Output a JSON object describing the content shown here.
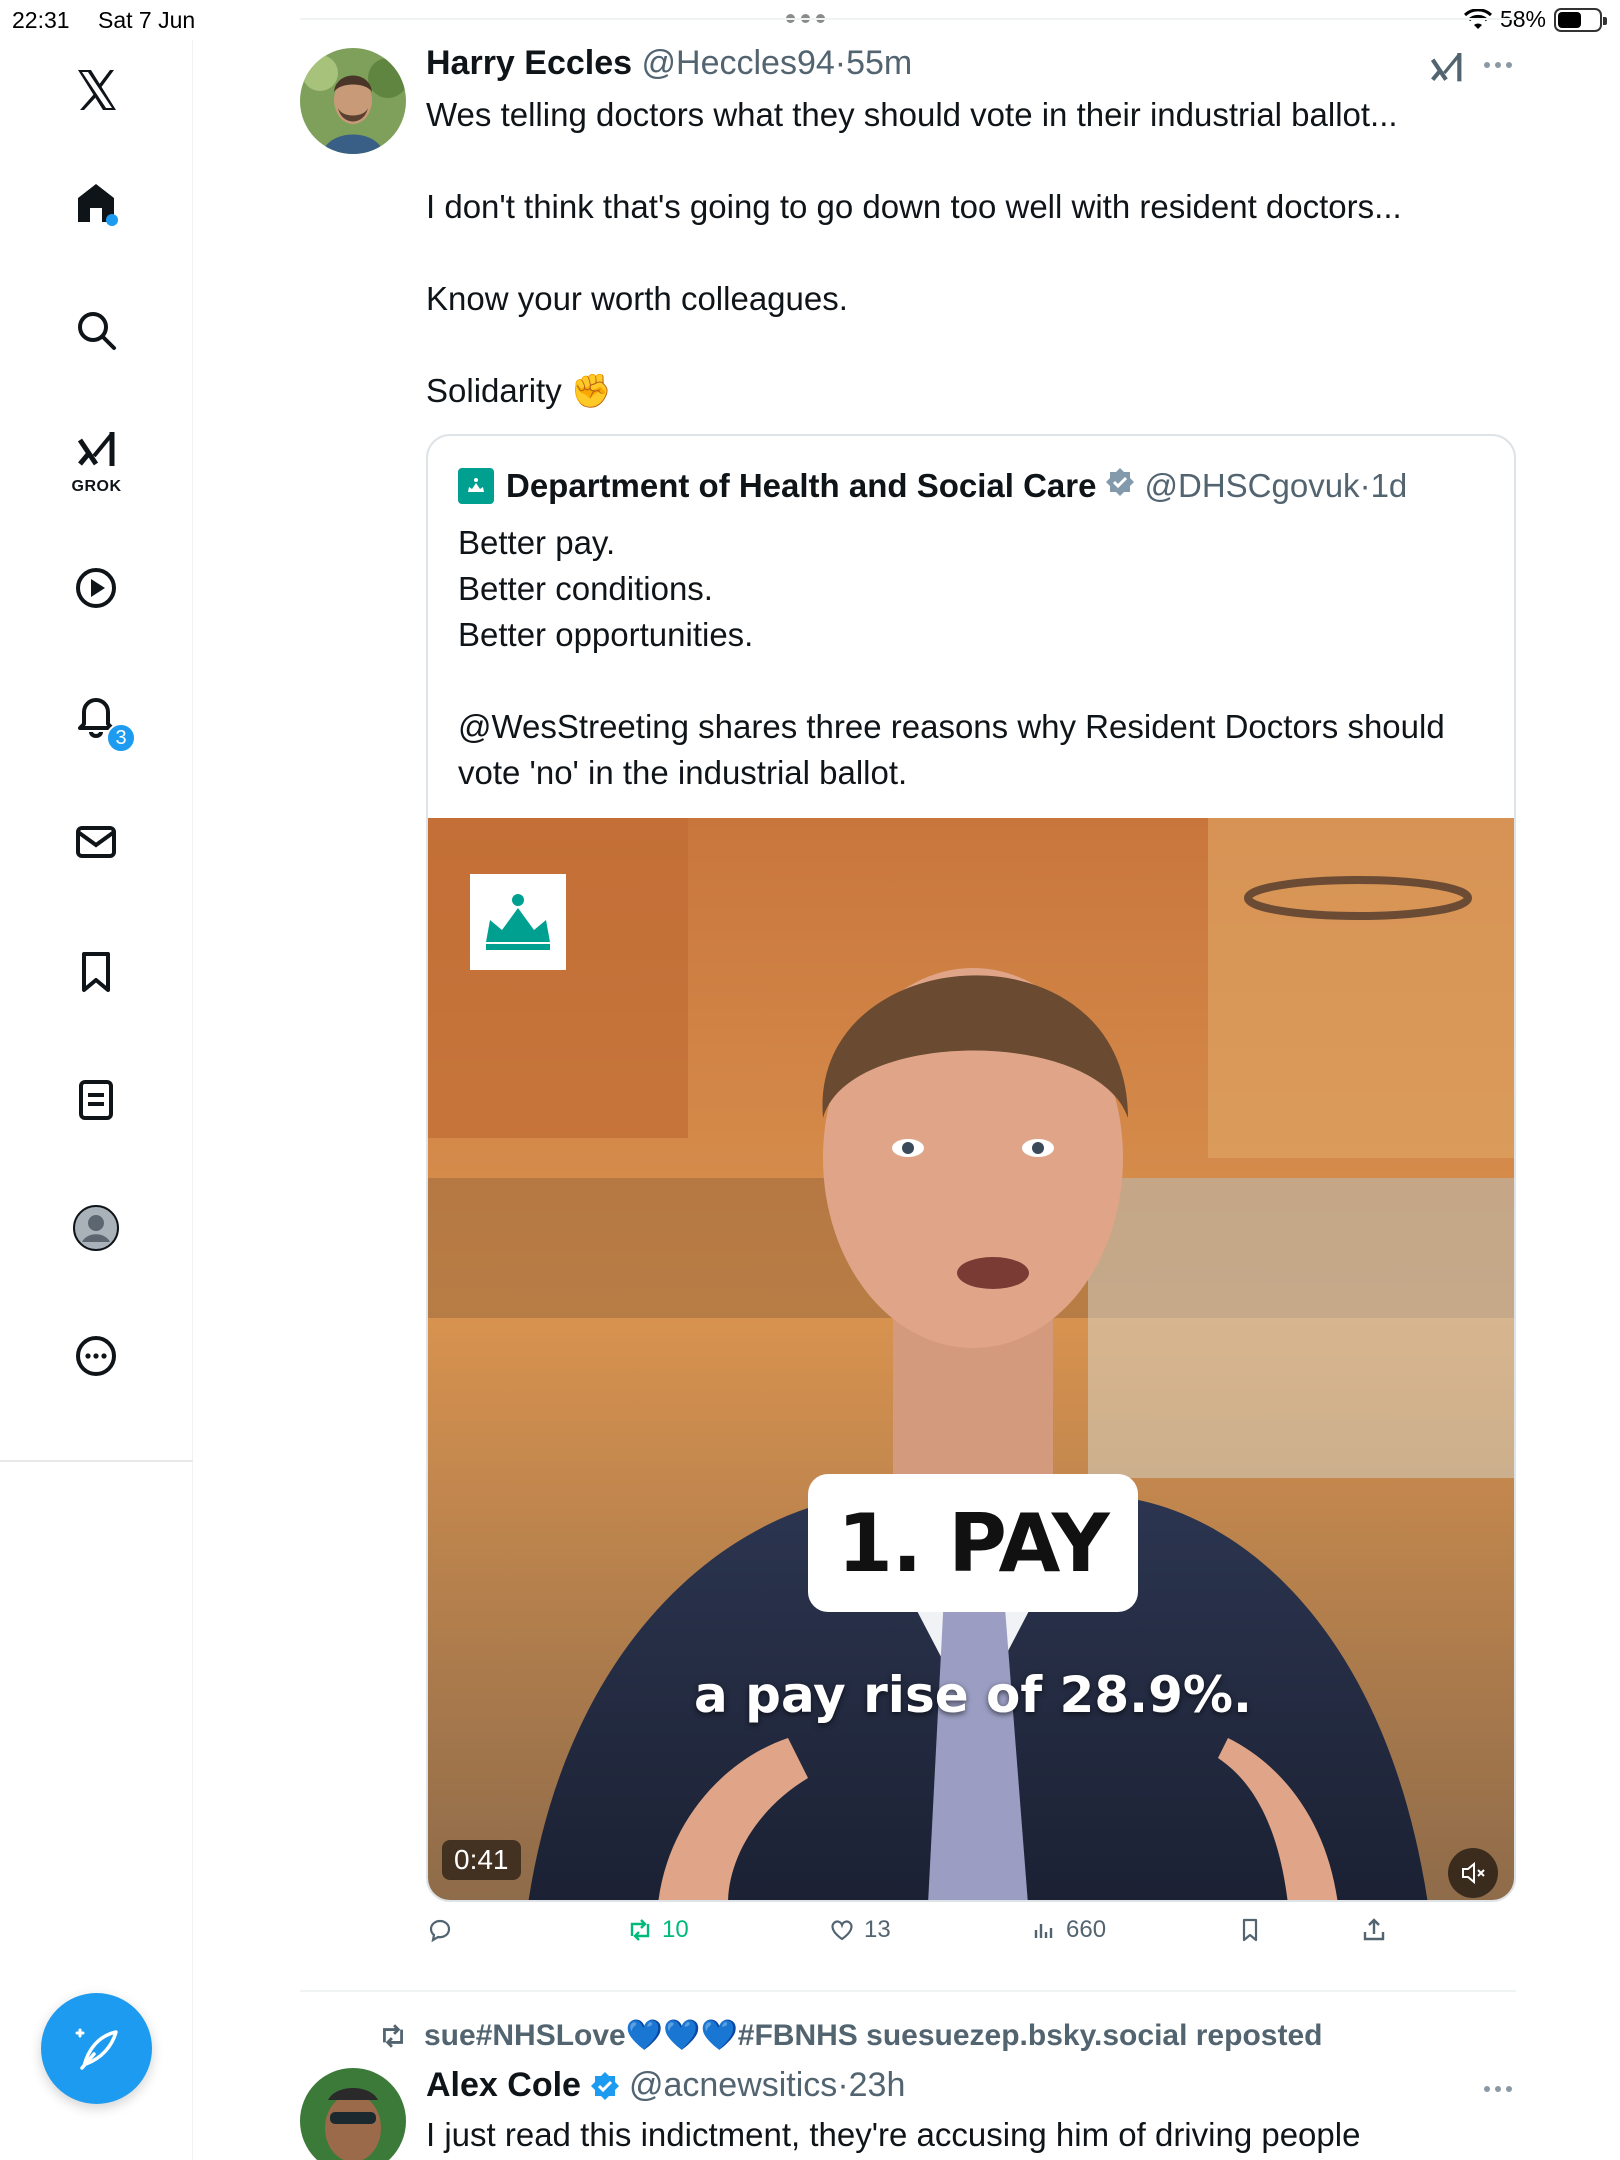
{
  "status_bar": {
    "time": "22:31",
    "date": "Sat 7 Jun",
    "battery": "58%",
    "battery_level": 0.58
  },
  "sidebar": {
    "items": [
      {
        "name": "x-logo",
        "icon": "x-logo-icon"
      },
      {
        "name": "home",
        "icon": "home-icon"
      },
      {
        "name": "search",
        "icon": "search-icon"
      },
      {
        "name": "grok",
        "icon": "grok-icon",
        "label": "GROK"
      },
      {
        "name": "video",
        "icon": "play-icon"
      },
      {
        "name": "notifications",
        "icon": "bell-icon",
        "badge": "3"
      },
      {
        "name": "messages",
        "icon": "mail-icon"
      },
      {
        "name": "bookmarks",
        "icon": "bookmark-icon"
      },
      {
        "name": "lists",
        "icon": "list-icon"
      },
      {
        "name": "profile",
        "icon": "profile-icon"
      },
      {
        "name": "more",
        "icon": "more-circle-icon"
      }
    ],
    "compose_icon": "compose-icon"
  },
  "tweet": {
    "author_name": "Harry Eccles",
    "author_handle": "@Heccles94",
    "separator": "·",
    "time": "55m",
    "lines": [
      "Wes telling doctors what they should vote in their industrial ballot...",
      "I don't think that's going to go down too well with resident doctors...",
      "Know your worth colleagues.",
      "Solidarity ✊"
    ],
    "quote": {
      "author_name": "Department of Health and Social Care",
      "author_handle": "@DHSCgovuk",
      "separator": "·",
      "time": "1d",
      "lines": [
        "Better pay.",
        "Better conditions.",
        "Better opportunities.",
        "@WesStreeting shares three reasons why Resident Doctors should",
        "vote 'no' in the industrial ballot."
      ],
      "video": {
        "overlay_title": "1. PAY",
        "caption": "a pay rise of 28.9%.",
        "duration": "0:41"
      }
    },
    "actions": {
      "replies": "",
      "reposts": "10",
      "likes": "13",
      "views": "660"
    }
  },
  "next_tweet": {
    "repost_by": "sue#NHSLove💙💙💙#FBNHS suesuezep.bsky.social reposted",
    "author_name": "Alex Cole",
    "author_handle": "@acnewsitics",
    "separator": "·",
    "time": "23h",
    "text": "I just read this indictment, they're accusing him of driving people"
  },
  "colors": {
    "accent": "#1d9bf0",
    "repost_green": "#00ba7c",
    "secondary_text": "#536471",
    "dhsc_teal": "#00a091"
  }
}
